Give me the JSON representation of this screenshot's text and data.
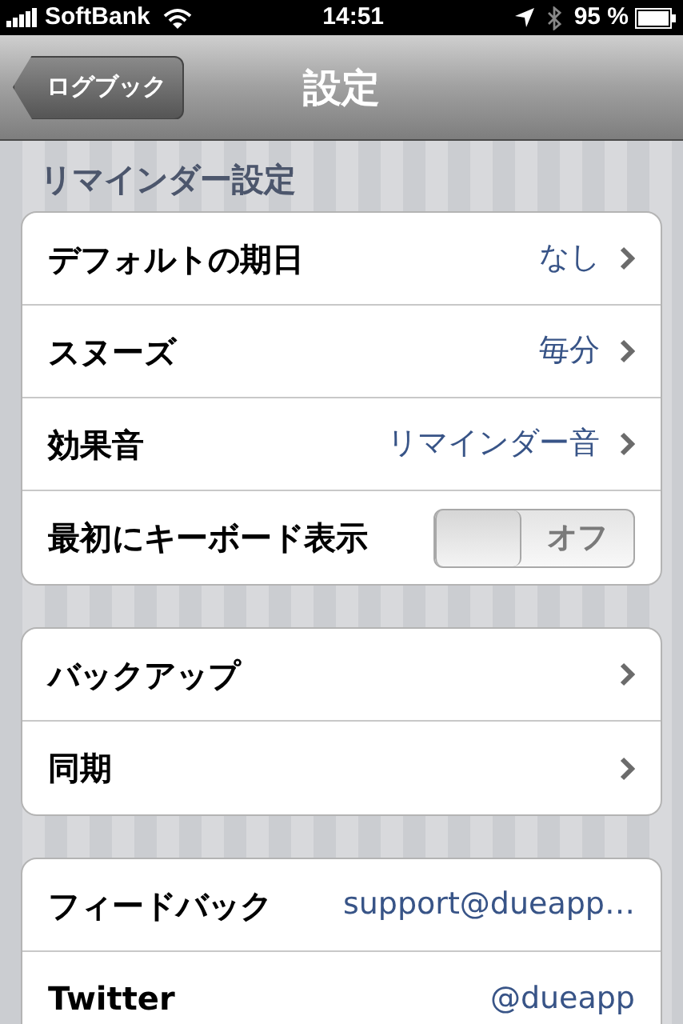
{
  "status_bar": {
    "carrier": "SoftBank",
    "time": "14:51",
    "battery": "95 %"
  },
  "nav": {
    "back": "ログブック",
    "title": "設定"
  },
  "sections": [
    {
      "header": "リマインダー設定",
      "rows": [
        {
          "kind": "disclosure",
          "label": "デフォルトの期日",
          "value": "なし"
        },
        {
          "kind": "disclosure",
          "label": "スヌーズ",
          "value": "毎分"
        },
        {
          "kind": "disclosure",
          "label": "効果音",
          "value": "リマインダー音"
        },
        {
          "kind": "toggle",
          "label": "最初にキーボード表示",
          "on": false,
          "state_label": "オフ"
        }
      ]
    },
    {
      "rows": [
        {
          "kind": "disclosure",
          "label": "バックアップ"
        },
        {
          "kind": "disclosure",
          "label": "同期"
        }
      ]
    },
    {
      "rows": [
        {
          "kind": "link",
          "label": "フィードバック",
          "value": "support@dueapp…"
        },
        {
          "kind": "link",
          "label": "Twitter",
          "value": "@dueapp"
        }
      ]
    }
  ]
}
